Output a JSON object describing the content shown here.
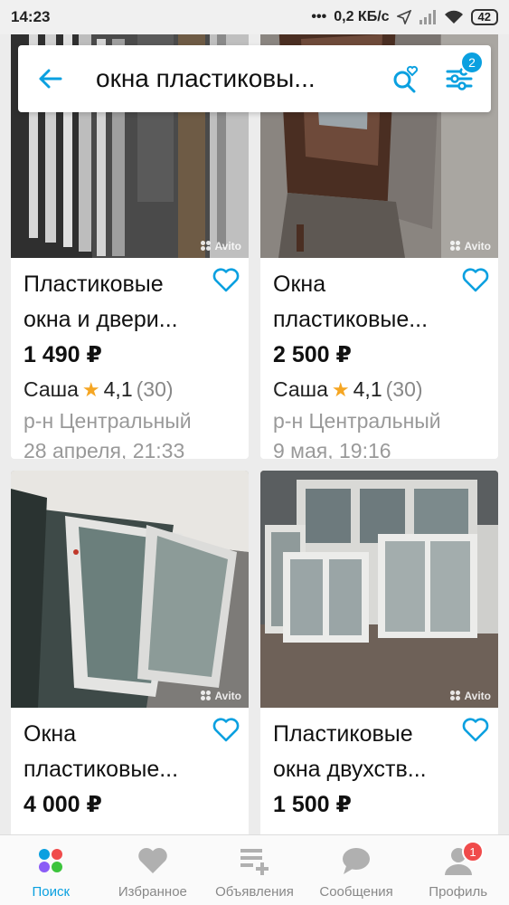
{
  "status_bar": {
    "time": "14:23",
    "network_speed": "0,2 КБ/с",
    "battery": "42"
  },
  "search": {
    "query": "окна пластиковы...",
    "filter_count": "2"
  },
  "listings": [
    {
      "title_line1": "Пластиковые",
      "title_line2": "окна и двери...",
      "price": "1 490 ₽",
      "seller": "Саша",
      "rating": "4,1",
      "reviews": "(30)",
      "location": "р-н Центральный",
      "date": "28 апреля, 21:33",
      "watermark": "Avito"
    },
    {
      "title_line1": "Окна",
      "title_line2": "пластиковые...",
      "price": "2 500 ₽",
      "seller": "Саша",
      "rating": "4,1",
      "reviews": "(30)",
      "location": "р-н Центральный",
      "date": "9 мая, 19:16",
      "watermark": "Avito"
    },
    {
      "title_line1": "Окна",
      "title_line2": "пластиковые...",
      "price": "4 000 ₽",
      "watermark": "Avito"
    },
    {
      "title_line1": "Пластиковые",
      "title_line2": "окна двухств...",
      "price": "1 500 ₽",
      "watermark": "Avito"
    }
  ],
  "bottom_nav": {
    "search": "Поиск",
    "favorites": "Избранное",
    "ads": "Объявления",
    "messages": "Сообщения",
    "profile": "Профиль",
    "profile_badge": "1"
  },
  "colors": {
    "accent": "#0aa0e0",
    "star": "#f5a623",
    "badge_red": "#f04b4b"
  }
}
